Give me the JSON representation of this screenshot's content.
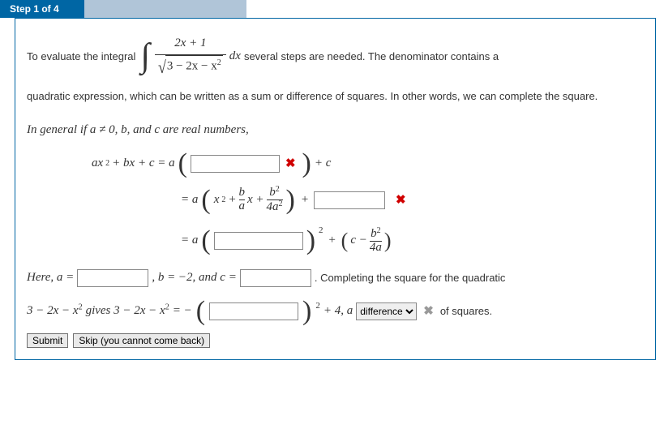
{
  "step": {
    "label": "Step 1 of 4"
  },
  "intro": {
    "t1": "To evaluate the integral ",
    "frac_num": "2x + 1",
    "frac_den_inside": "3 − 2x − x",
    "dx": " dx",
    "t2": " several steps are needed. The denominator contains a",
    "t3": "quadratic expression, which can be written as a sum or difference of squares. In other words, we can complete the square.",
    "t4": "In general if a ≠ 0,  b, and c are real numbers,"
  },
  "eq1": {
    "lhs": "ax",
    "lhs2": " + bx + c = a",
    "rhs_tail": " + c"
  },
  "eq2": {
    "pre": "= a",
    "inner1": "x",
    "plus": " + ",
    "frac1_num": "b",
    "frac1_den": "a",
    "xlabel": "x + ",
    "frac2_num": "b",
    "frac2_den": "4a",
    "post_plus": " + "
  },
  "eq3": {
    "pre": "= a",
    "mid": " + ",
    "c_minus": "c − ",
    "frac_num": "b",
    "frac_den": "4a"
  },
  "here": {
    "t1": "Here, a = ",
    "t2": " ,   b = −2,  and  c = ",
    "t3": " .   Completing the square for the quadratic"
  },
  "final": {
    "t1": "3 − 2x − x",
    "t2": "  gives  3 − 2x − x",
    "t3": " = −",
    "t4": " + 4,  a ",
    "dropdown_value": "difference",
    "t5": "  of squares."
  },
  "buttons": {
    "submit": "Submit",
    "skip": "Skip (you cannot come back)"
  }
}
